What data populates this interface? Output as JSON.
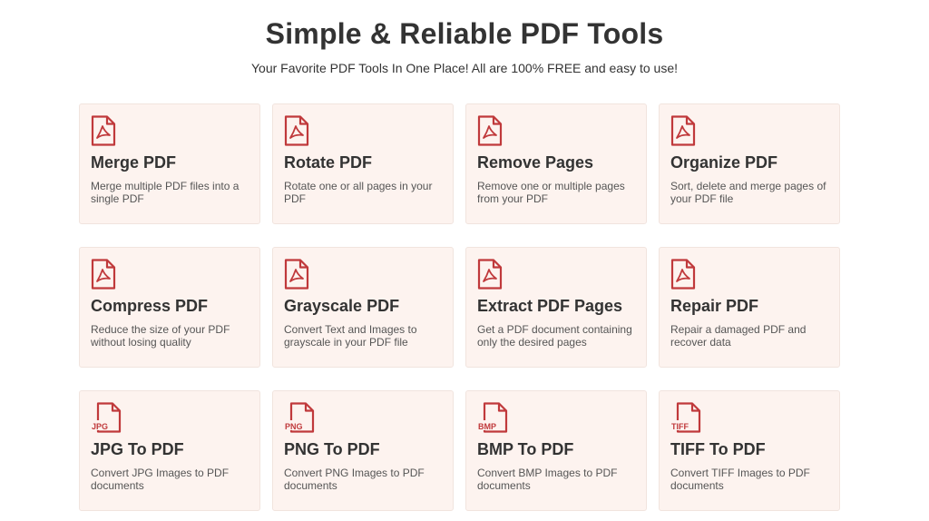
{
  "header": {
    "title": "Simple & Reliable PDF Tools",
    "subtitle": "Your Favorite PDF Tools In One Place! All are 100% FREE and easy to use!"
  },
  "colors": {
    "accent": "#c0393b",
    "card_background": "#fdf3ef",
    "text": "#333333"
  },
  "tools": [
    {
      "name": "Merge PDF",
      "description": "Merge multiple PDF files into a single PDF",
      "icon": "pdf-file-icon"
    },
    {
      "name": "Rotate PDF",
      "description": "Rotate one or all pages in your PDF",
      "icon": "pdf-file-icon"
    },
    {
      "name": "Remove Pages",
      "description": "Remove one or multiple pages from your PDF",
      "icon": "pdf-file-icon"
    },
    {
      "name": "Organize PDF",
      "description": "Sort, delete and merge pages of your PDF file",
      "icon": "pdf-file-icon"
    },
    {
      "name": "Compress PDF",
      "description": "Reduce the size of your PDF without losing quality",
      "icon": "pdf-file-icon"
    },
    {
      "name": "Grayscale PDF",
      "description": "Convert Text and Images to grayscale in your PDF file",
      "icon": "pdf-file-icon"
    },
    {
      "name": "Extract PDF Pages",
      "description": "Get a PDF document containing only the desired pages",
      "icon": "pdf-file-icon"
    },
    {
      "name": "Repair PDF",
      "description": "Repair a damaged PDF and recover data",
      "icon": "pdf-file-icon"
    },
    {
      "name": "JPG To PDF",
      "description": "Convert JPG Images to PDF documents",
      "icon": "jpg-file-icon",
      "icon_label": "JPG"
    },
    {
      "name": "PNG To PDF",
      "description": "Convert PNG Images to PDF documents",
      "icon": "png-file-icon",
      "icon_label": "PNG"
    },
    {
      "name": "BMP To PDF",
      "description": "Convert BMP Images to PDF documents",
      "icon": "bmp-file-icon",
      "icon_label": "BMP"
    },
    {
      "name": "TIFF To PDF",
      "description": "Convert TIFF Images to PDF documents",
      "icon": "tiff-file-icon",
      "icon_label": "TIFF"
    }
  ]
}
